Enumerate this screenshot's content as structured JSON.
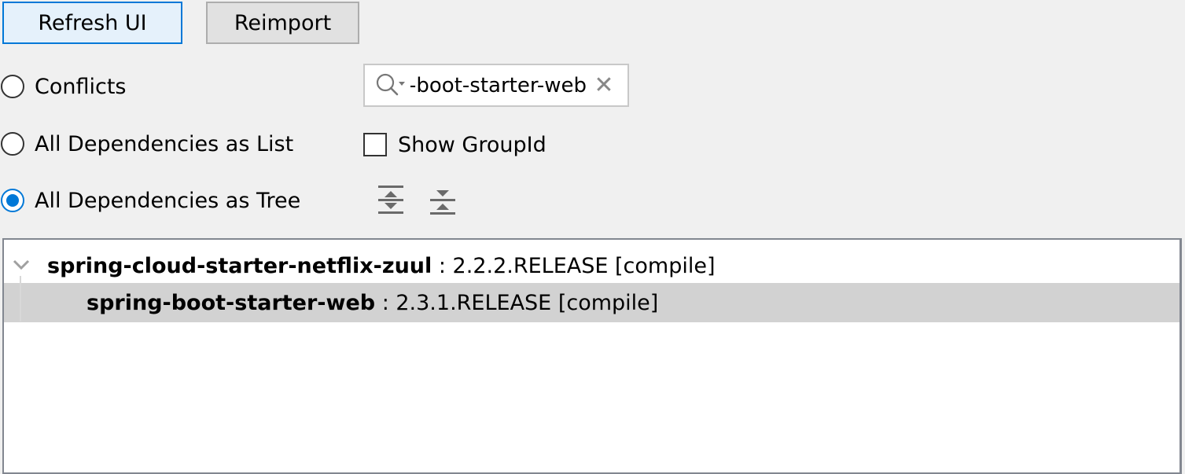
{
  "toolbar": {
    "refresh_label": "Refresh UI",
    "reimport_label": "Reimport"
  },
  "view_modes": [
    {
      "label": "Conflicts",
      "selected": false
    },
    {
      "label": "All Dependencies as List",
      "selected": false
    },
    {
      "label": "All Dependencies as Tree",
      "selected": true
    }
  ],
  "search": {
    "value": "spring-boot-starter-web",
    "icon": "search-icon",
    "clear_icon": "close-icon"
  },
  "show_group_id": {
    "label": "Show GroupId",
    "checked": false
  },
  "tree_tools": {
    "expand_icon": "expand-all-icon",
    "collapse_icon": "collapse-all-icon"
  },
  "tree": {
    "nodes": [
      {
        "artifact": "spring-cloud-starter-netflix-zuul",
        "details": " : 2.2.2.RELEASE [compile]",
        "expanded": true,
        "selected": false
      },
      {
        "artifact": "spring-boot-starter-web",
        "details": " : 2.3.1.RELEASE [compile]",
        "selected": true
      }
    ]
  },
  "colors": {
    "accent": "#0078d7",
    "selection": "#d2d2d2"
  }
}
